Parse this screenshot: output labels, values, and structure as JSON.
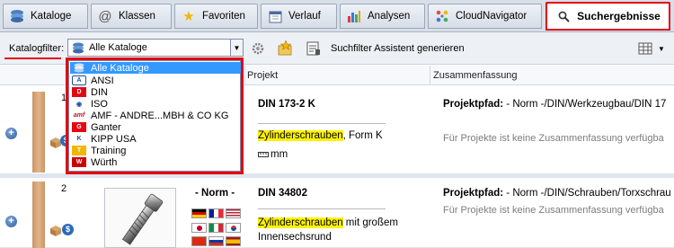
{
  "tabs": [
    {
      "label": "Kataloge",
      "icon": "catalog-icon"
    },
    {
      "label": "Klassen",
      "icon": "at-sign-icon"
    },
    {
      "label": "Favoriten",
      "icon": "star-icon"
    },
    {
      "label": "Verlauf",
      "icon": "calendar-icon"
    },
    {
      "label": "Analysen",
      "icon": "bar-chart-icon"
    },
    {
      "label": "CloudNavigator",
      "icon": "cloud-navigator-icon"
    },
    {
      "label": "Suchergebnisse",
      "icon": "search-icon",
      "active": true
    }
  ],
  "toolbar": {
    "filter_label": "Katalogfilter:",
    "filter_value": "Alle Kataloge",
    "assistant_label": "Suchfilter Assistent generieren"
  },
  "dropdown": {
    "options": [
      {
        "label": "Alle Kataloge",
        "icon": "catalog-icon",
        "selected": true
      },
      {
        "label": "ANSI",
        "icon": "ansi-logo-icon"
      },
      {
        "label": "DIN",
        "icon": "din-logo-icon"
      },
      {
        "label": "ISO",
        "icon": "iso-logo-icon"
      },
      {
        "label": "AMF - ANDRE...MBH & CO KG",
        "icon": "amf-logo-icon"
      },
      {
        "label": "Ganter",
        "icon": "ganter-logo-icon"
      },
      {
        "label": "KIPP USA",
        "icon": "kipp-logo-icon"
      },
      {
        "label": "Training",
        "icon": "training-logo-icon"
      },
      {
        "label": "Würth",
        "icon": "wuerth-logo-icon"
      }
    ]
  },
  "columns": {
    "project": "Projekt",
    "summary": "Zusammenfassung"
  },
  "results": [
    {
      "number": "1",
      "title": "DIN 173-2 K",
      "desc_highlight": "Zylinderschrauben",
      "desc_rest": ", Form K",
      "unit": "mm",
      "path_label": "Projektpfad:",
      "path_value": " - Norm -/DIN/Werkzeugbau/DIN 17",
      "summary_note": "Für Projekte ist keine Zusammenfassung verfügba"
    },
    {
      "number": "2",
      "norm": "- Norm -",
      "title": "DIN 34802",
      "desc_highlight": "Zylinderschrauben",
      "desc_rest": " mit großem",
      "desc_line2": "Innensechsrund",
      "path_label": "Projektpfad:",
      "path_value": " - Norm -/DIN/Schrauben/Torxschrau",
      "summary_note": "Für Projekte ist keine Zusammenfassung verfügba"
    }
  ],
  "colors": {
    "accent_red": "#e30613",
    "selection_blue": "#3399ff",
    "highlight_yellow": "#fff200"
  }
}
